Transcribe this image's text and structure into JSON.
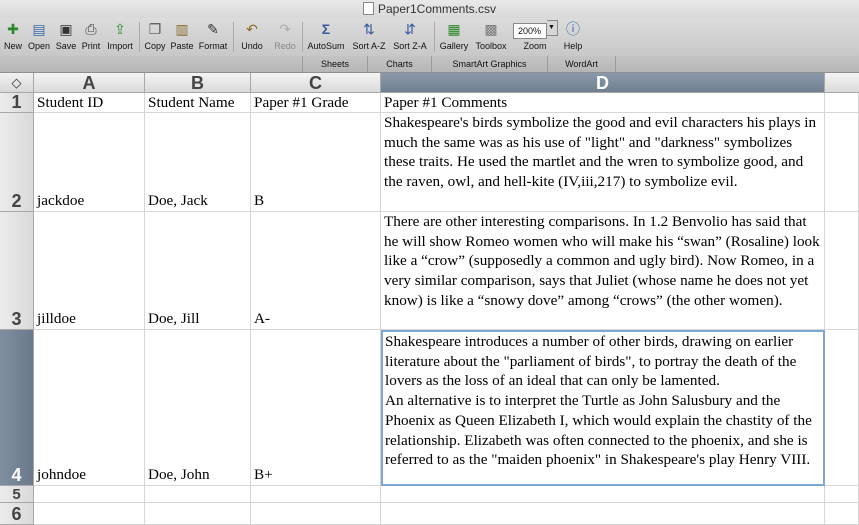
{
  "window": {
    "title": "Paper1Comments.csv"
  },
  "toolbar": {
    "items": [
      {
        "label": "New",
        "icon": "new-icon"
      },
      {
        "label": "Open",
        "icon": "open-icon"
      },
      {
        "label": "Save",
        "icon": "save-icon"
      },
      {
        "label": "Print",
        "icon": "print-icon"
      },
      {
        "label": "Import",
        "icon": "import-icon"
      },
      {
        "label": "Copy",
        "icon": "copy-icon"
      },
      {
        "label": "Paste",
        "icon": "paste-icon"
      },
      {
        "label": "Format",
        "icon": "format-icon"
      },
      {
        "label": "Undo",
        "icon": "undo-icon"
      },
      {
        "label": "Redo",
        "icon": "redo-icon"
      },
      {
        "label": "AutoSum",
        "icon": "autosum-icon"
      },
      {
        "label": "Sort A-Z",
        "icon": "sort-az-icon"
      },
      {
        "label": "Sort Z-A",
        "icon": "sort-za-icon"
      },
      {
        "label": "Gallery",
        "icon": "gallery-icon"
      },
      {
        "label": "Toolbox",
        "icon": "toolbox-icon"
      },
      {
        "label": "Zoom",
        "icon": "zoom-icon"
      },
      {
        "label": "Help",
        "icon": "help-icon"
      }
    ],
    "zoom_value": "200%"
  },
  "ribbon": {
    "tabs": [
      "Sheets",
      "Charts",
      "SmartArt Graphics",
      "WordArt"
    ]
  },
  "sheet": {
    "columns": [
      "A",
      "B",
      "C",
      "D"
    ],
    "rows": [
      "1",
      "2",
      "3",
      "4",
      "5",
      "6"
    ],
    "selected_column": "D",
    "selected_row": "4",
    "cells": {
      "r1": {
        "a": "Student ID",
        "b": "Student Name",
        "c": "Paper #1 Grade",
        "d": "Paper #1 Comments"
      },
      "r2": {
        "a": "jackdoe",
        "b": "Doe, Jack",
        "c": "B",
        "d": "Shakespeare's birds symbolize the good and evil characters his plays in much the same was as his use of \"light\" and \"darkness\" symbolizes these traits. He used the martlet and the wren to symbolize good, and the raven, owl, and hell-kite (IV,iii,217) to symbolize evil."
      },
      "r3": {
        "a": "jilldoe",
        "b": "Doe, Jill",
        "c": "A-",
        "d": "There are other interesting comparisons. In 1.2 Benvolio has said that he will show Romeo women who will make his “swan” (Rosaline) look like a “crow” (supposedly a common and ugly bird). Now Romeo, in a very similar comparison, says that Juliet (whose name he does not yet know) is like a “snowy dove” among “crows” (the other women)."
      },
      "r4": {
        "a": "johndoe",
        "b": "Doe, John",
        "c": "B+",
        "d": "Shakespeare introduces a number of other birds, drawing on earlier literature about the \"parliament of birds\", to portray the death of the lovers as the loss of an ideal that can only be lamented.\nAn alternative is to interpret the Turtle as John Salusbury and the Phoenix as Queen Elizabeth I, which would explain the chastity of the relationship.  Elizabeth was often connected to the phoenix, and she is referred to as the \"maiden phoenix\" in Shakespeare's play Henry VIII."
      }
    }
  }
}
